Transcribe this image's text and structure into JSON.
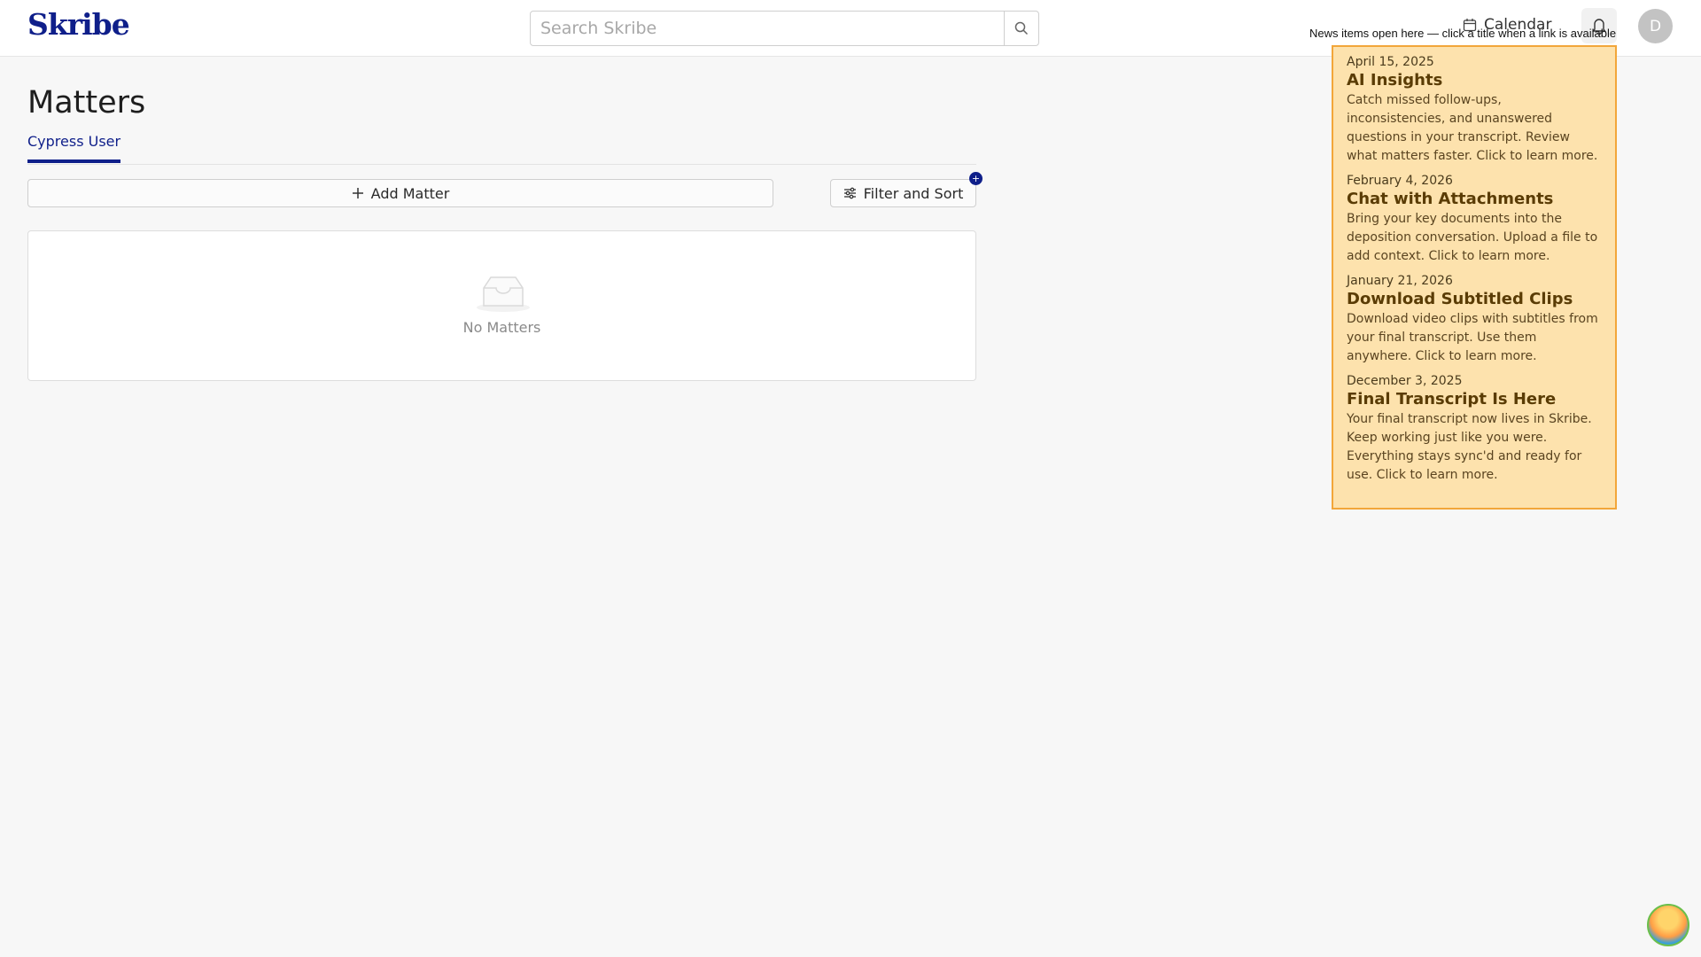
{
  "app": {
    "logo": "Skribe"
  },
  "header": {
    "search_placeholder": "Search Skribe",
    "calendar_label": "Calendar",
    "avatar_initial": "D",
    "news_tooltip": "News items open here — click a title when a link is available"
  },
  "page": {
    "title": "Matters",
    "tabs": [
      {
        "label": "Cypress User",
        "active": true
      }
    ]
  },
  "toolbar": {
    "add_label": "Add Matter",
    "filter_label": "Filter and Sort",
    "filter_badge": "+"
  },
  "empty_state": {
    "text": "No Matters"
  },
  "news": {
    "items": [
      {
        "date": "April 15, 2025",
        "title": "AI Insights",
        "body": "Catch missed follow-ups, inconsistencies, and unanswered questions in your transcript. Review what matters faster. Click to learn more."
      },
      {
        "date": "February 4, 2026",
        "title": "Chat with Attachments",
        "body": "Bring your key documents into the deposition conversation. Upload a file to add context. Click to learn more."
      },
      {
        "date": "January 21, 2026",
        "title": "Download Subtitled Clips",
        "body": "Download video clips with subtitles from your final transcript. Use them anywhere. Click to learn more."
      },
      {
        "date": "December 3, 2025",
        "title": "Final Transcript Is Here",
        "body": "Your final transcript now lives in Skribe. Keep working just like you were. Everything stays sync'd and ready for use. Click to learn more."
      }
    ]
  },
  "colors": {
    "brand": "#0f1f8a",
    "news_bg": "#fde2ad",
    "news_border": "#f2a63a",
    "page_bg": "#f7f7f7"
  }
}
